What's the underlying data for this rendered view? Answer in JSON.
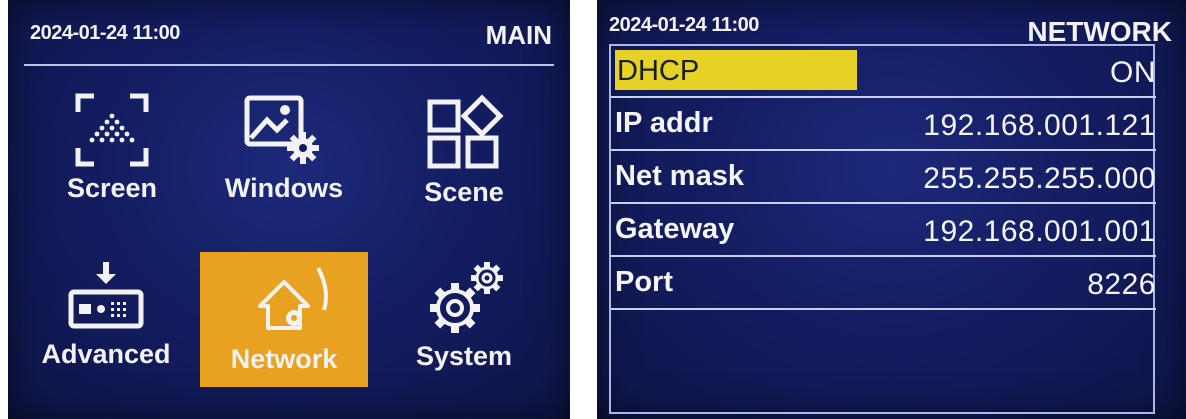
{
  "main_screen": {
    "datetime": "2024-01-24 11:00",
    "title": "MAIN",
    "menu": [
      {
        "label": "Screen",
        "icon": "screen-icon"
      },
      {
        "label": "Windows",
        "icon": "windows-icon"
      },
      {
        "label": "Scene",
        "icon": "scene-icon"
      },
      {
        "label": "Advanced",
        "icon": "advanced-icon"
      },
      {
        "label": "Network",
        "icon": "network-icon",
        "selected": true
      },
      {
        "label": "System",
        "icon": "system-icon"
      }
    ]
  },
  "network_screen": {
    "datetime": "2024-01-24 11:00",
    "title": "NETWORK",
    "rows": [
      {
        "label": "DHCP",
        "value": "ON",
        "selected": true
      },
      {
        "label": "IP addr",
        "value": "192.168.001.121"
      },
      {
        "label": "Net mask",
        "value": "255.255.255.000"
      },
      {
        "label": "Gateway",
        "value": "192.168.001.001"
      },
      {
        "label": "Port",
        "value": "8226"
      }
    ]
  },
  "colors": {
    "screen_bg": "#141d62",
    "selected_tile": "#e8a21f",
    "selected_row": "#e6d226",
    "text": "#f2f2f2"
  }
}
